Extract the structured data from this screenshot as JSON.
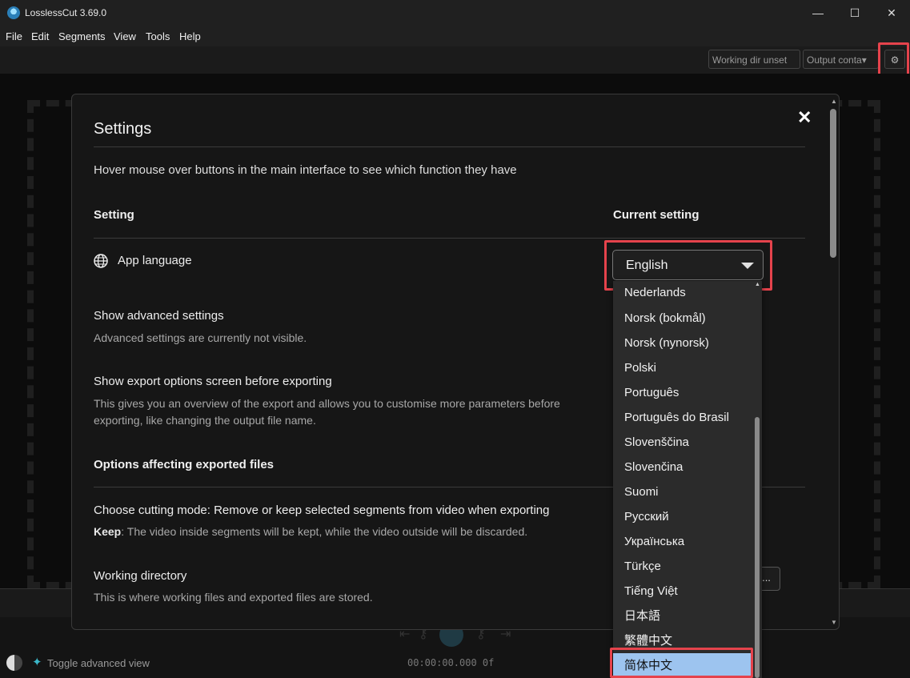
{
  "window": {
    "title": "LosslessCut 3.69.0",
    "minimize_glyph": "—",
    "maximize_glyph": "☐",
    "close_glyph": "✕"
  },
  "menu": {
    "items": [
      "File",
      "Edit",
      "Segments",
      "View",
      "Tools",
      "Help"
    ]
  },
  "toolbar": {
    "working_dir_label": "Working dir unset",
    "output_container_label": "Output conta",
    "output_container_caret": "▾",
    "gear_icon": "⚙"
  },
  "settings": {
    "title": "Settings",
    "close_glyph": "✕",
    "hint": "Hover mouse over buttons in the main interface to see which function they have",
    "col_setting": "Setting",
    "col_current": "Current setting",
    "app_language_label": "App language",
    "app_language_value": "English",
    "advanced_label": "Show advanced settings",
    "advanced_desc": "Advanced settings are currently not visible.",
    "export_screen_label": "Show export options screen before exporting",
    "export_screen_desc": "This gives you an overview of the export and allows you to customise more parameters before exporting, like changing the output file name.",
    "section_exported": "Options affecting exported files",
    "cutting_mode_label": "Choose cutting mode: Remove or keep selected segments from video when exporting",
    "keep_word": "Keep",
    "keep_desc": ": The video inside segments will be kept, while the video outside will be discarded.",
    "working_dir_label": "Working directory",
    "working_dir_desc": "This is where working files and exported files are stored.",
    "browse_label": "..."
  },
  "language_dropdown": {
    "options": [
      "Nederlands",
      "Norsk (bokmål)",
      "Norsk (nynorsk)",
      "Polski",
      "Português",
      "Português do Brasil",
      "Slovenščina",
      "Slovenčina",
      "Suomi",
      "Русский",
      "Українська",
      "Türkçe",
      "Tiếng Việt",
      "日本語",
      "繁體中文",
      "简体中文"
    ],
    "highlighted": "简体中文"
  },
  "bottom": {
    "toggle_advanced_label": "Toggle advanced view",
    "timecode": "00:00:00.000 0f"
  },
  "colors": {
    "highlight_box": "#e5434c",
    "selected_option": "#9dc4ef",
    "background": "#141414"
  }
}
